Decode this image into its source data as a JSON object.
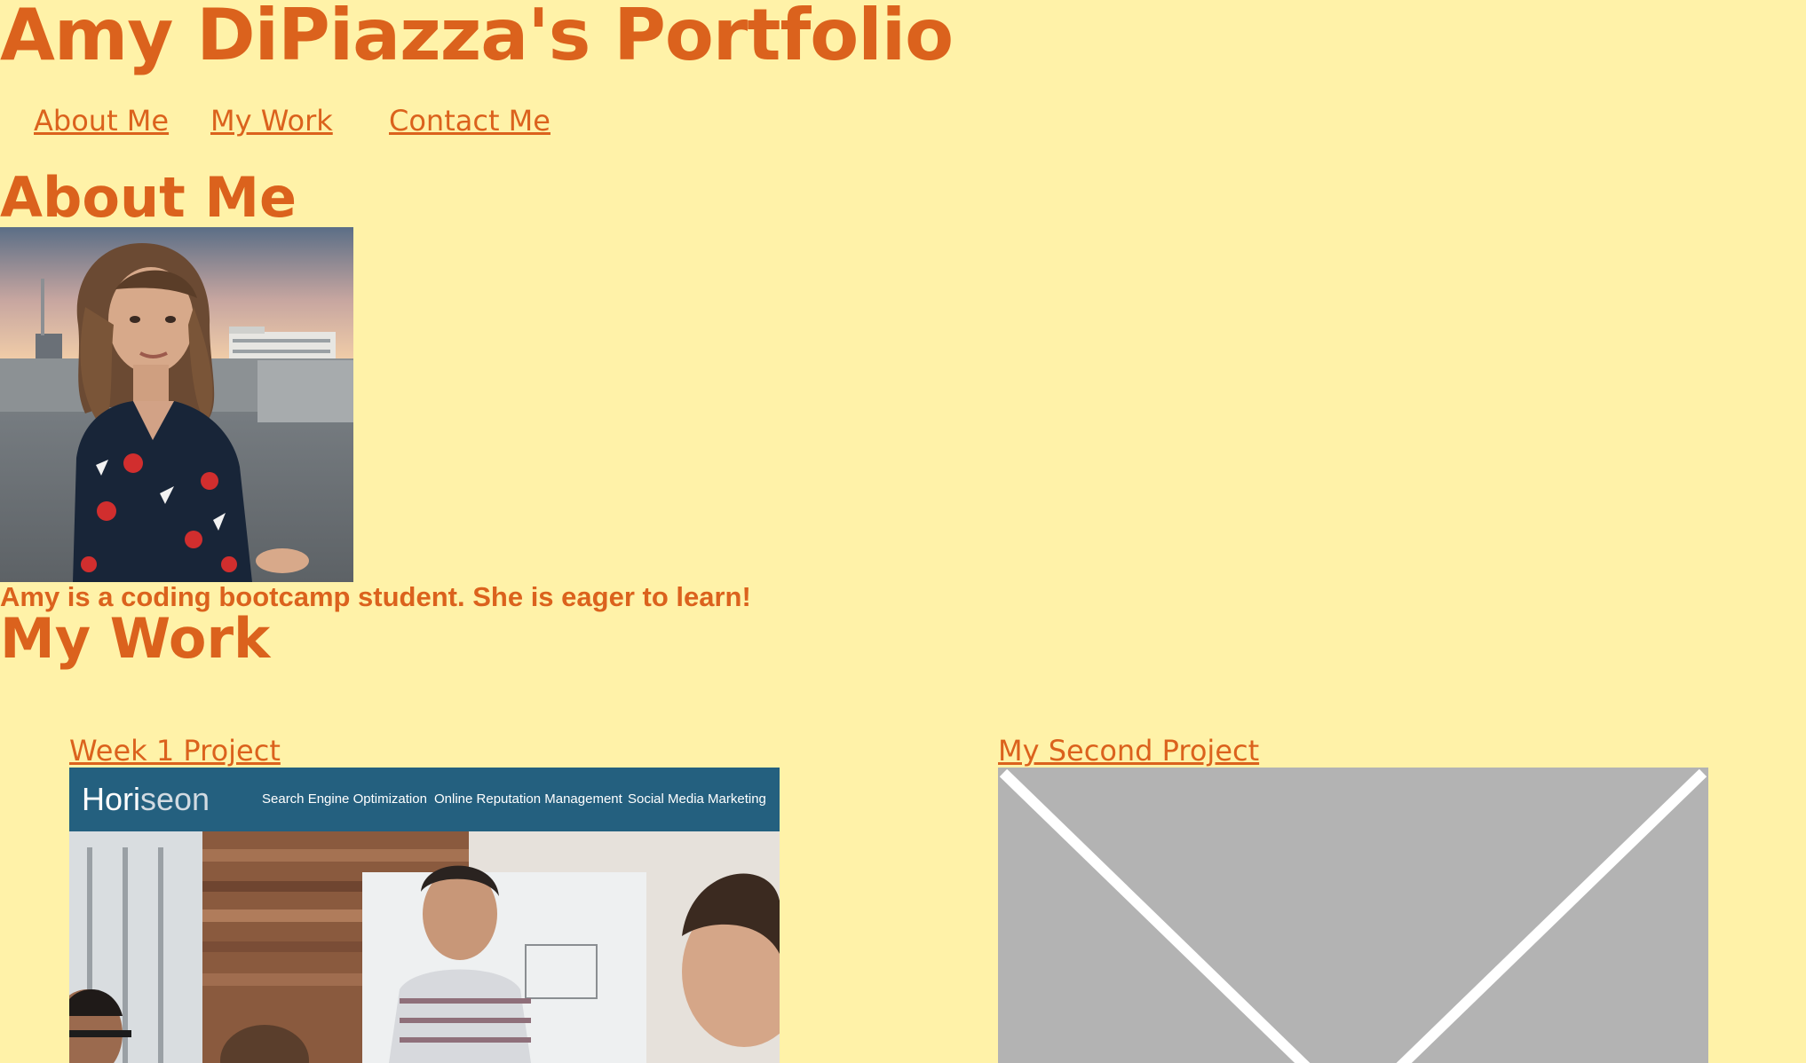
{
  "header": {
    "title": "Amy DiPiazza's Portfolio",
    "nav": [
      {
        "label": "About Me"
      },
      {
        "label": "My Work"
      },
      {
        "label": "Contact Me"
      }
    ]
  },
  "about": {
    "heading": "About Me",
    "bio": "Amy is a coding bootcamp student. She is eager to learn!"
  },
  "work": {
    "heading": "My Work",
    "projects": [
      {
        "title": "Week 1 Project",
        "screenshot": {
          "logo_prefix": "Hori",
          "logo_highlight": "seon",
          "nav": [
            "Search Engine Optimization",
            "Online Reputation Management",
            "Social Media Marketing"
          ]
        }
      },
      {
        "title": "My Second Project",
        "image": "placeholder-image"
      }
    ]
  },
  "colors": {
    "background": "#fff2a8",
    "accent": "#db621d",
    "horiseon_header": "#24607f",
    "placeholder": "#b3b3b3"
  }
}
